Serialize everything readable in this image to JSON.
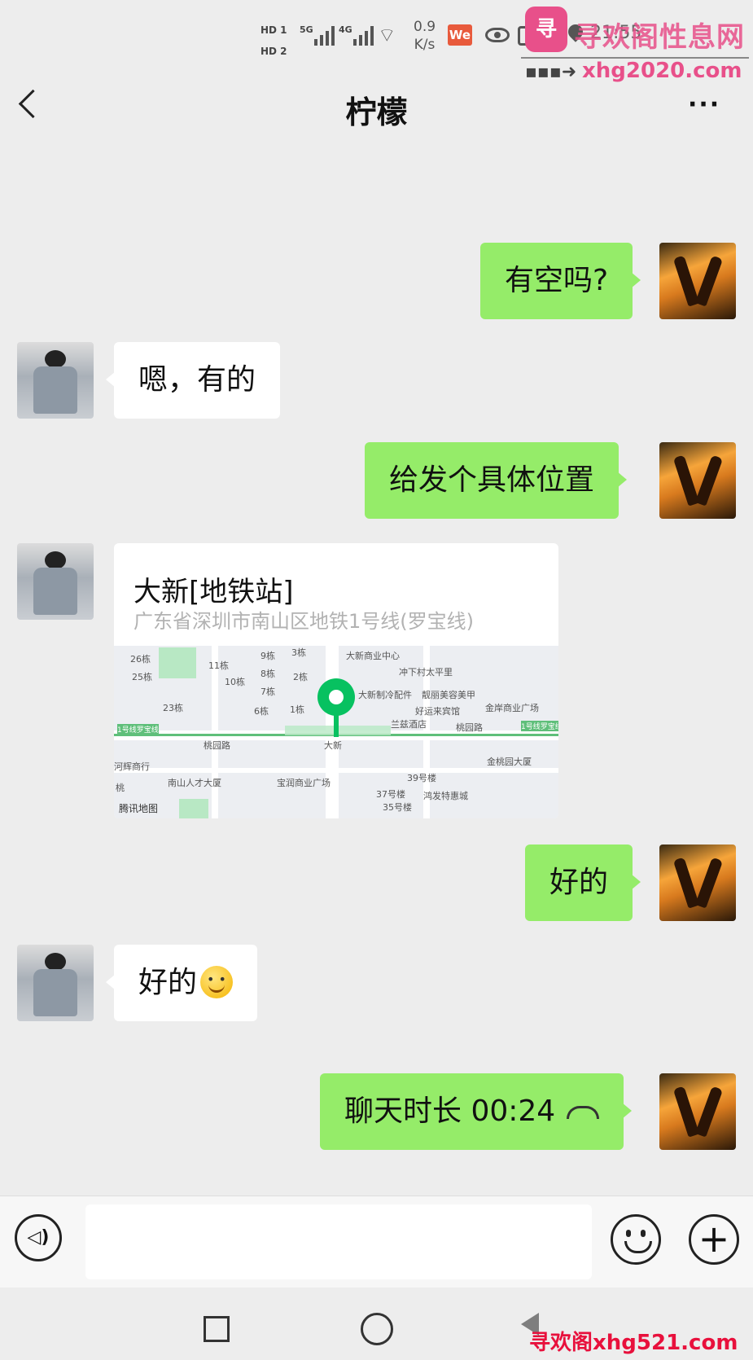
{
  "status_bar": {
    "hd1": "HD 1",
    "hd2": "HD 2",
    "sig1": "5G",
    "sig2": "4G",
    "speed_value": "0.9",
    "speed_unit": "K/s",
    "app_icon": "We",
    "time": "21:55"
  },
  "watermark": {
    "logo_char": "寻",
    "title": "寻欢阁性息网",
    "url": "xhg2020.com",
    "bottom": "寻欢阁xhg521.com"
  },
  "header": {
    "title": "柠檬",
    "more": "···"
  },
  "messages": [
    {
      "from": "me",
      "text": "有空吗?"
    },
    {
      "from": "other",
      "text": "嗯，有的"
    },
    {
      "from": "me",
      "text": "给发个具体位置"
    },
    {
      "from": "other",
      "type": "location"
    },
    {
      "from": "me",
      "text": "好的"
    },
    {
      "from": "other",
      "text": "好的"
    },
    {
      "from": "me",
      "text": "聊天时长 00:24"
    }
  ],
  "location": {
    "name": "大新[地铁站]",
    "address": "广东省深圳市南山区地铁1号线(罗宝线)",
    "map_provider": "腾讯地图",
    "map_labels": {
      "l1": "26栋",
      "l2": "25栋",
      "l3": "23栋",
      "l4": "11栋",
      "l5": "10栋",
      "l6": "9栋",
      "l7": "8栋",
      "l8": "7栋",
      "l9": "6栋",
      "l10": "3栋",
      "l11": "2栋",
      "l12": "1栋",
      "l13": "大新商业中心",
      "l14": "冲下村太平里",
      "l15": "大新制冷配件",
      "l16": "靓丽美容美甲",
      "l17": "好运来宾馆",
      "l18": "金岸商业广场",
      "l19": "兰兹酒店",
      "l20": "桃园路",
      "l21": "桃园路",
      "l22": "大新",
      "l23": "金桃园大厦",
      "l24": "南山人才大厦",
      "l25": "宝润商业广场",
      "l26": "39号楼",
      "l27": "37号楼",
      "l28": "35号楼",
      "l29": "鸿发特惠城",
      "l30": "1号线罗宝线",
      "l31": "1号线罗宝线",
      "l32": "河辉商行",
      "l33": "桃"
    }
  },
  "colors": {
    "sent_bubble": "#95ec69",
    "received_bubble": "#ffffff",
    "background": "#ededed",
    "pin": "#07c160"
  },
  "icons": {
    "back": "back-chevron-icon",
    "more": "more-dots-icon",
    "voice": "voice-icon",
    "emoji": "emoji-icon",
    "plus": "plus-icon",
    "hangup": "phone-hangup-icon"
  },
  "input": {
    "value": ""
  }
}
